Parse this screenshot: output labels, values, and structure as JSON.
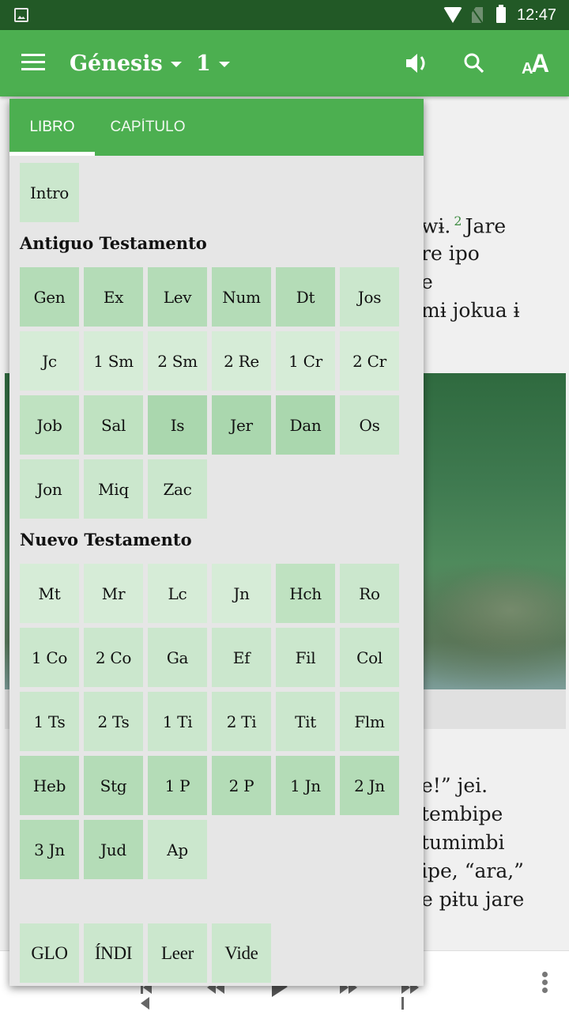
{
  "status_bar": {
    "time": "12:47"
  },
  "app_bar": {
    "book": "Génesis",
    "chapter": "1",
    "icons": [
      "menu-icon",
      "speaker-icon",
      "search-icon",
      "text-size-icon"
    ],
    "accent_color": "#4caf50",
    "status_color": "#225926"
  },
  "reader": {
    "lines_top": [
      {
        "before": "wɨ.",
        "verse": "2",
        "after": "Jare"
      },
      {
        "text": "re ipo"
      },
      {
        "text": "e"
      },
      {
        "text": "mɨ jokua ɨ"
      }
    ],
    "lines_bottom": [
      "e!” jei.",
      " tembipe",
      "tumimbi",
      "ipe, “ara,”",
      "e pɨtu jare"
    ]
  },
  "popup": {
    "tabs": [
      {
        "label": "LIBRO",
        "active": true
      },
      {
        "label": "CAPÍTULO",
        "active": false
      }
    ],
    "intro": "Intro",
    "old_testament_title": "Antiguo Testamento",
    "old_testament": [
      "Gen",
      "Ex",
      "Lev",
      "Num",
      "Dt",
      "Jos",
      "Jc",
      "1 Sm",
      "2 Sm",
      "2 Re",
      "1 Cr",
      "2 Cr",
      "Job",
      "Sal",
      "Is",
      "Jer",
      "Dan",
      "Os",
      "Jon",
      "Miq",
      "Zac"
    ],
    "new_testament_title": "Nuevo Testamento",
    "new_testament": [
      "Mt",
      "Mr",
      "Lc",
      "Jn",
      "Hch",
      "Ro",
      "1 Co",
      "2 Co",
      "Ga",
      "Ef",
      "Fil",
      "Col",
      "1 Ts",
      "2 Ts",
      "1 Ti",
      "2 Ti",
      "Tit",
      "Flm",
      "Heb",
      "Stg",
      "1 P",
      "2 P",
      "1 Jn",
      "2 Jn",
      "3 Jn",
      "Jud",
      "Ap"
    ],
    "extras": [
      "GLO",
      "ÍNDI",
      "Leer",
      "Vide"
    ]
  },
  "bottom_bar": {
    "controls": [
      "skip-start-icon",
      "rewind-icon",
      "play-icon",
      "fast-forward-icon",
      "skip-end-icon",
      "more-vert-icon"
    ]
  }
}
